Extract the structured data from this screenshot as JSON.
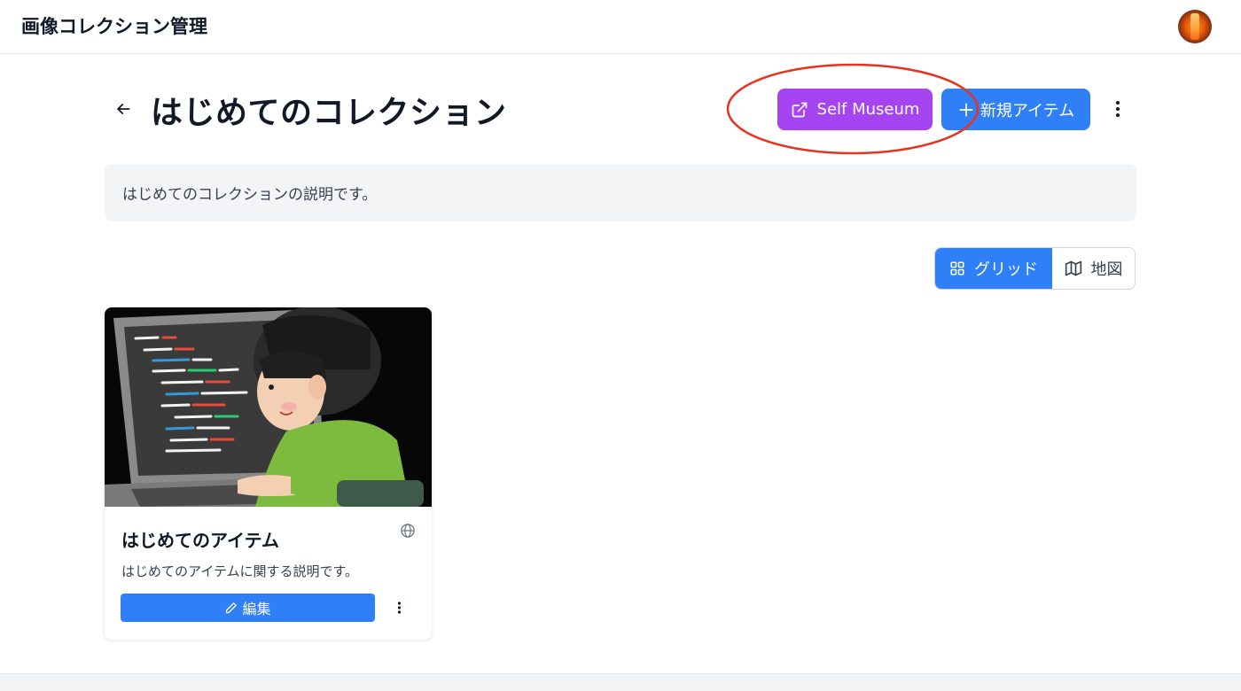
{
  "header": {
    "app_title": "画像コレクション管理",
    "avatar_icon": "user-avatar"
  },
  "collection": {
    "title": "はじめてのコレクション",
    "description": "はじめてのコレクションの説明です。",
    "back_icon": "arrow-left-icon",
    "self_museum_label": "Self Museum",
    "self_museum_icon": "external-link-icon",
    "new_item_label": "新規アイテム",
    "new_item_icon": "plus-icon",
    "more_icon": "more-vertical-icon"
  },
  "view_toggle": {
    "grid_label": "グリッド",
    "grid_icon": "grid-icon",
    "map_label": "地図",
    "map_icon": "map-icon",
    "selected": "grid"
  },
  "items": [
    {
      "title": "はじめてのアイテム",
      "description": "はじめてのアイテムに関する説明です。",
      "edit_label": "編集",
      "edit_icon": "pencil-icon",
      "visibility_icon": "globe-icon",
      "more_icon": "more-vertical-icon",
      "image": "illustration of a person coding at a laptop"
    }
  ],
  "colors": {
    "museum_button": "#a544f0",
    "primary_button": "#2f80f6",
    "highlight_ellipse": "#e8321e",
    "description_bg": "#f3f4f6"
  }
}
